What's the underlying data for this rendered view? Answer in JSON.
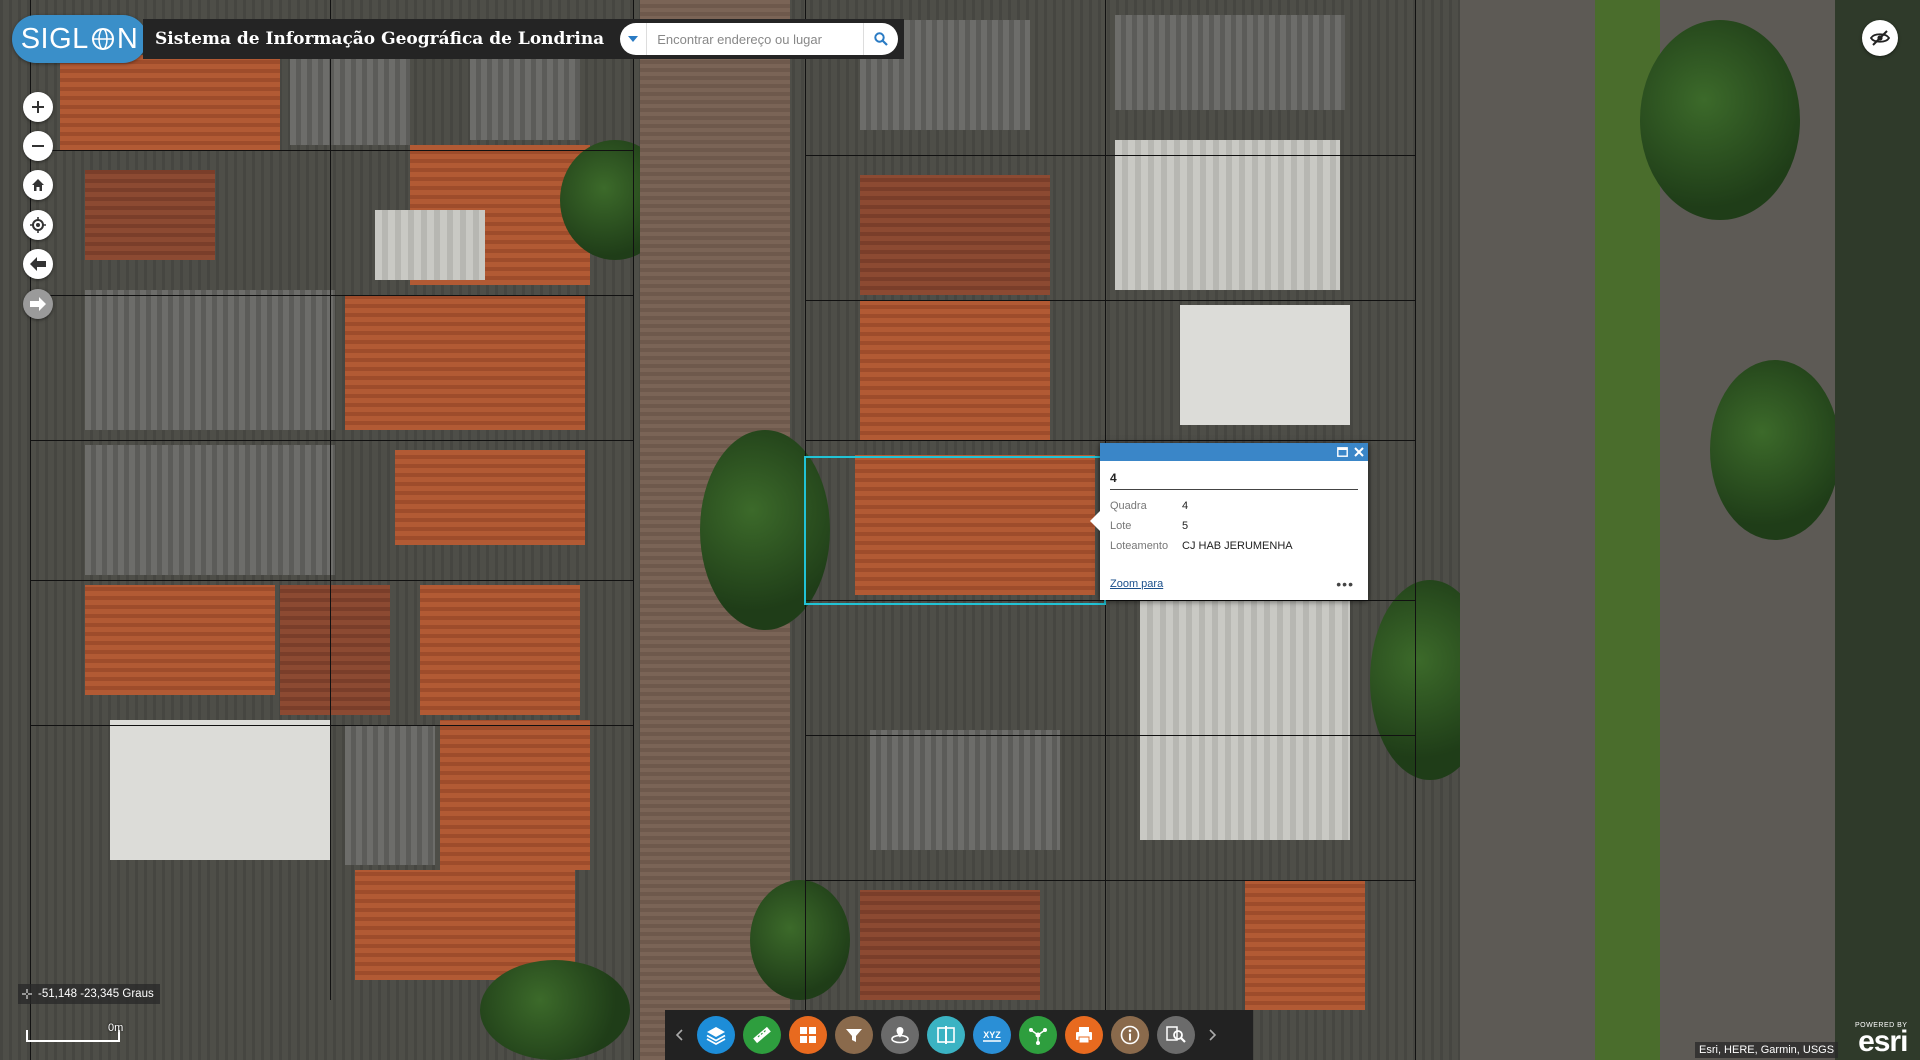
{
  "header": {
    "logo_text": "SIGL",
    "logo_text_end": "N",
    "title": "Sistema de Informação Geográfica de Londrina"
  },
  "search": {
    "placeholder": "Encontrar endereço ou lugar",
    "value": ""
  },
  "nav": {
    "zoom_in_icon": "plus-icon",
    "zoom_out_icon": "minus-icon",
    "home_icon": "home-icon",
    "locate_icon": "locate-icon",
    "back_icon": "arrow-left-icon",
    "forward_icon": "arrow-right-icon"
  },
  "popup": {
    "title": "4",
    "fields": [
      {
        "label": "Quadra",
        "value": "4"
      },
      {
        "label": "Lote",
        "value": "5"
      },
      {
        "label": "Loteamento",
        "value": "CJ HAB JERUMENHA"
      }
    ],
    "zoom_label": "Zoom para",
    "more_label": "•••"
  },
  "coordinates": {
    "text": "-51,148 -23,345 Graus"
  },
  "scale": {
    "label": "0m"
  },
  "toolbar": {
    "prev_icon": "chevron-left-icon",
    "next_icon": "chevron-right-icon",
    "tools": [
      {
        "name": "layers-icon",
        "color": "#1d8dd8"
      },
      {
        "name": "measure-icon",
        "color": "#2e9e3e"
      },
      {
        "name": "basemap-gallery-icon",
        "color": "#e86a1f"
      },
      {
        "name": "filter-icon",
        "color": "#8a6a4c"
      },
      {
        "name": "draw-icon",
        "color": "#6b6b6b"
      },
      {
        "name": "swipe-icon",
        "color": "#3bb3c3"
      },
      {
        "name": "coordinate-xyz-icon",
        "color": "#2a8fd6"
      },
      {
        "name": "share-icon",
        "color": "#2e9e3e"
      },
      {
        "name": "print-icon",
        "color": "#e86a1f"
      },
      {
        "name": "info-icon",
        "color": "#8a6a4c"
      },
      {
        "name": "query-icon",
        "color": "#6b6b6b"
      }
    ]
  },
  "attribution": {
    "text": "Esri, HERE, Garmin, USGS",
    "powered_by": "POWERED BY",
    "brand": "esri"
  },
  "colors": {
    "accent": "#3a8fc9",
    "highlight": "#21c3d6",
    "header_bg": "#242424"
  }
}
